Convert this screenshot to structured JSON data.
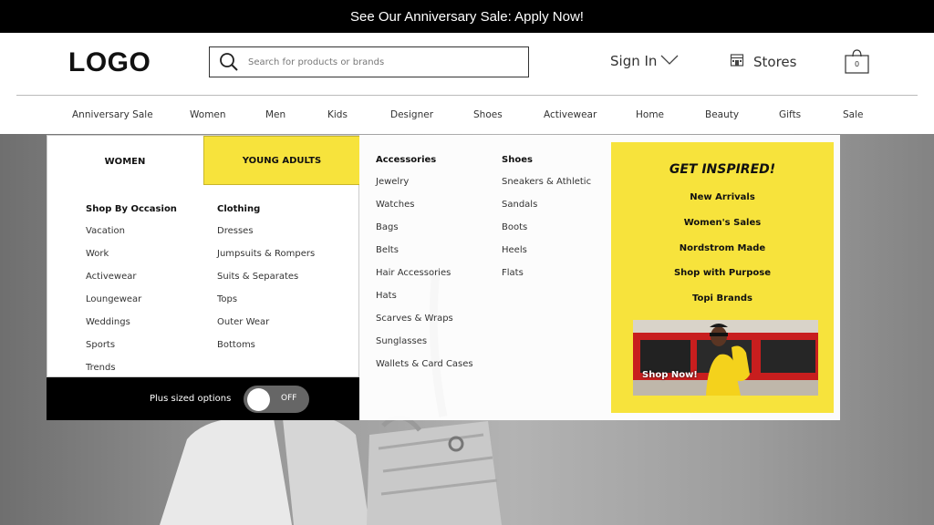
{
  "banner": {
    "text": "See Our Anniversary Sale: Apply Now!"
  },
  "header": {
    "logo": "LOGO",
    "search_placeholder": "Search for products or brands",
    "sign_in": "Sign In",
    "stores": "Stores",
    "bag_count": "0"
  },
  "nav": {
    "items": [
      "Anniversary Sale",
      "Women",
      "Men",
      "Kids",
      "Designer",
      "Shoes",
      "Activewear",
      "Home",
      "Beauty",
      "Gifts",
      "Sale"
    ]
  },
  "mega": {
    "tabs": {
      "women": "WOMEN",
      "young_adults": "YOUNG ADULTS"
    },
    "occasion": {
      "heading": "Shop By Occasion",
      "items": [
        "Vacation",
        "Work",
        "Activewear",
        "Loungewear",
        "Weddings",
        "Sports",
        "Trends"
      ]
    },
    "clothing": {
      "heading": "Clothing",
      "items": [
        "Dresses",
        "Jumpsuits & Rompers",
        "Suits & Separates",
        "Tops",
        "Outer Wear",
        "Bottoms"
      ]
    },
    "accessories": {
      "heading": "Accessories",
      "items": [
        "Jewelry",
        "Watches",
        "Bags",
        "Belts",
        "Hair Accessories",
        "Hats",
        "Scarves & Wraps",
        "Sunglasses",
        "Wallets & Card Cases"
      ]
    },
    "shoes": {
      "heading": "Shoes",
      "items": [
        "Sneakers & Athletic",
        "Sandals",
        "Boots",
        "Heels",
        "Flats"
      ]
    },
    "plus_sized": {
      "label": "Plus sized options",
      "state": "OFF"
    },
    "inspired": {
      "title": "GET INSPIRED!",
      "links": [
        "New Arrivals",
        "Women's Sales",
        "Nordstrom Made",
        "Shop with Purpose",
        "Topi Brands"
      ],
      "promo_label": "Shop Now!"
    }
  },
  "colors": {
    "accent_yellow": "#f7e33c",
    "banner_black": "#000000"
  }
}
